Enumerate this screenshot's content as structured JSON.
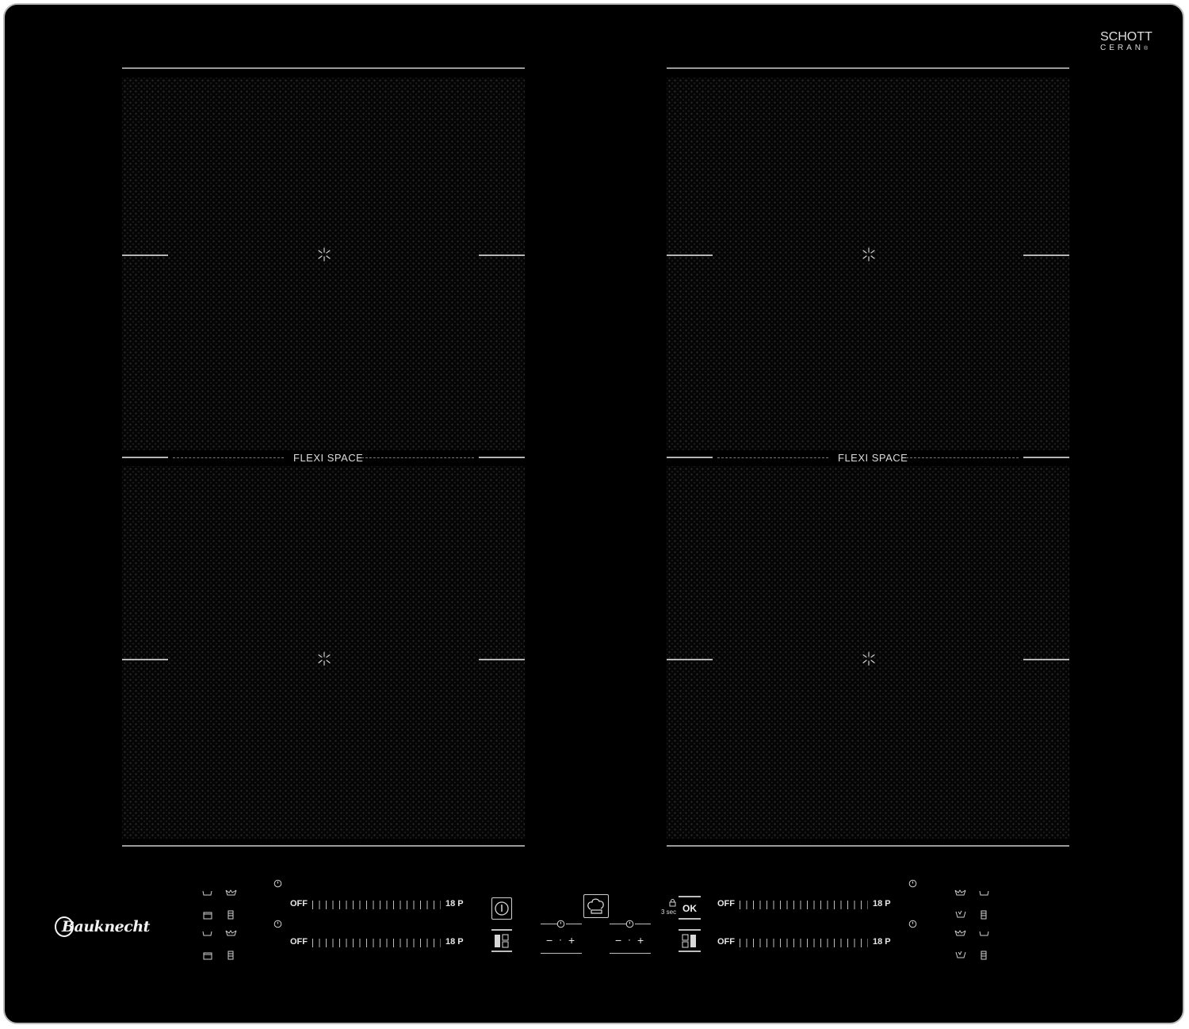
{
  "brand": {
    "logo_text": "Bauknecht",
    "glass_brand_line1": "SCHOTT",
    "glass_brand_line2": "CERAN",
    "glass_brand_mark": "®"
  },
  "cooking_areas": {
    "left": {
      "divider_label": "FLEXI SPACE"
    },
    "right": {
      "divider_label": "FLEXI SPACE"
    }
  },
  "sliders": [
    {
      "min_label": "OFF",
      "max_label": "18 P"
    },
    {
      "min_label": "OFF",
      "max_label": "18 P"
    },
    {
      "min_label": "OFF",
      "max_label": "18 P"
    },
    {
      "min_label": "OFF",
      "max_label": "18 P"
    }
  ],
  "controls": {
    "lock_hint": "3 sec",
    "ok_label": "OK",
    "timer_minus": "−",
    "timer_plus": "+",
    "timer_dot": "·"
  },
  "colors": {
    "panel": "#000000",
    "frame": "#b9b9b9",
    "markings": "#d0d0d0"
  }
}
